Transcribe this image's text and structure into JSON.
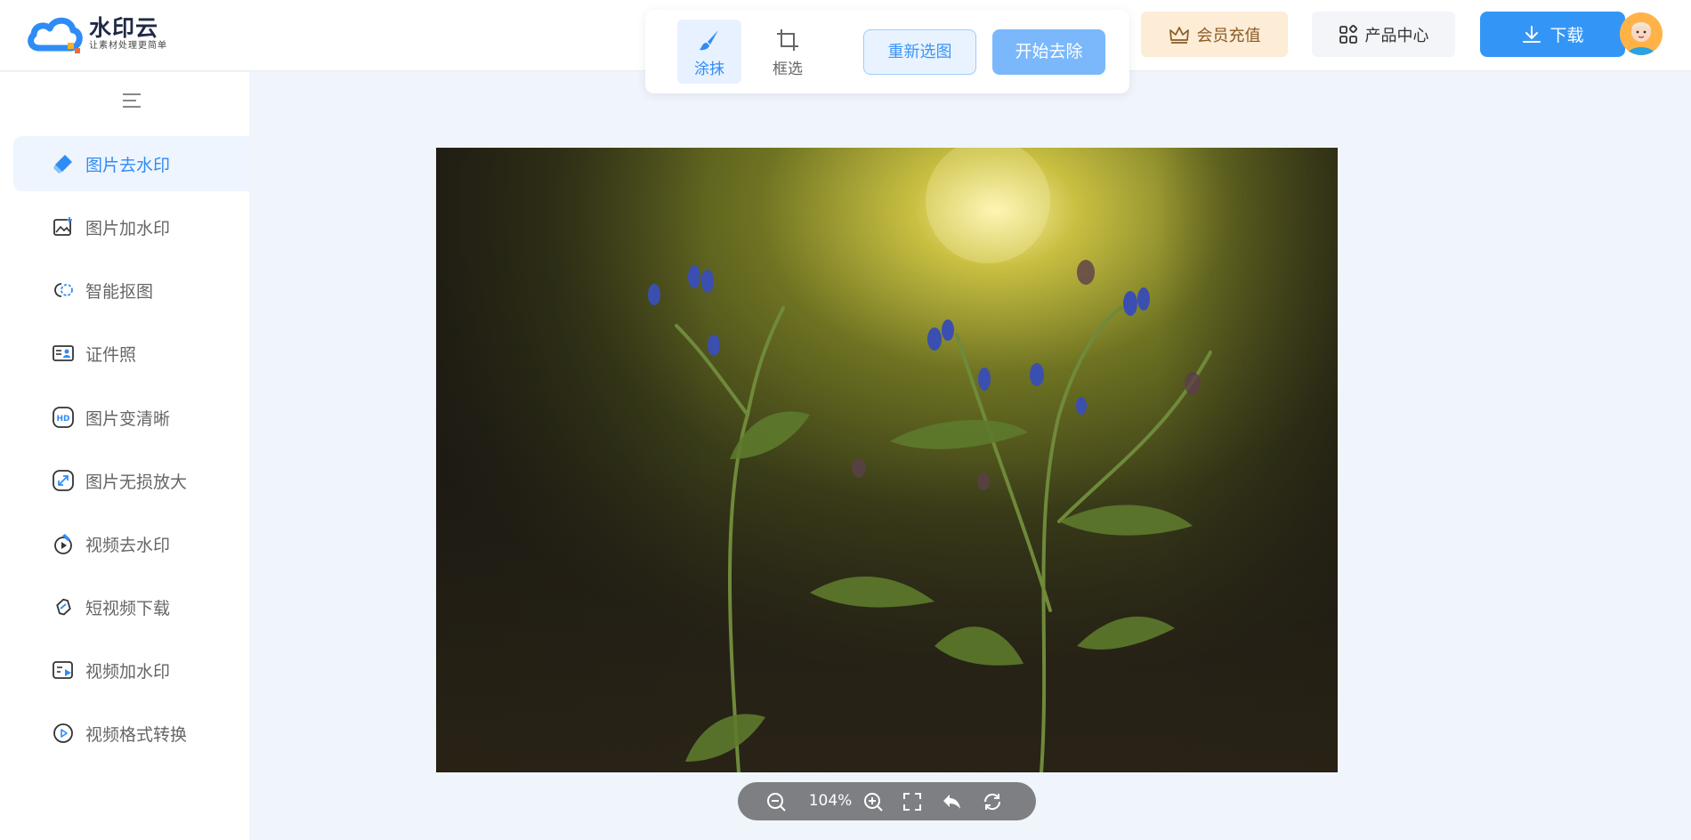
{
  "brand": {
    "name": "水印云",
    "slogan": "让素材处理更简单"
  },
  "toolbox": {
    "brush_label": "涂抹",
    "crop_label": "框选",
    "reselect_label": "重新选图",
    "start_label": "开始去除"
  },
  "header": {
    "vip_label": "会员充值",
    "products_label": "产品中心",
    "download_label": "下载"
  },
  "sidebar": {
    "items": [
      {
        "label": "图片去水印",
        "icon": "eraser-icon",
        "active": true
      },
      {
        "label": "图片加水印",
        "icon": "image-add-icon"
      },
      {
        "label": "智能抠图",
        "icon": "cutout-icon"
      },
      {
        "label": "证件照",
        "icon": "id-card-icon"
      },
      {
        "label": "图片变清晰",
        "icon": "hd-icon"
      },
      {
        "label": "图片无损放大",
        "icon": "enlarge-icon"
      },
      {
        "label": "视频去水印",
        "icon": "video-eraser-icon"
      },
      {
        "label": "短视频下载",
        "icon": "link-icon"
      },
      {
        "label": "视频加水印",
        "icon": "video-add-icon"
      },
      {
        "label": "视频格式转换",
        "icon": "play-circle-icon"
      }
    ]
  },
  "zoom": {
    "value": "104%"
  },
  "colors": {
    "accent": "#3396f7",
    "sidebar_active_bg": "#eef5ff",
    "canvas_bg": "#f0f4fb"
  }
}
